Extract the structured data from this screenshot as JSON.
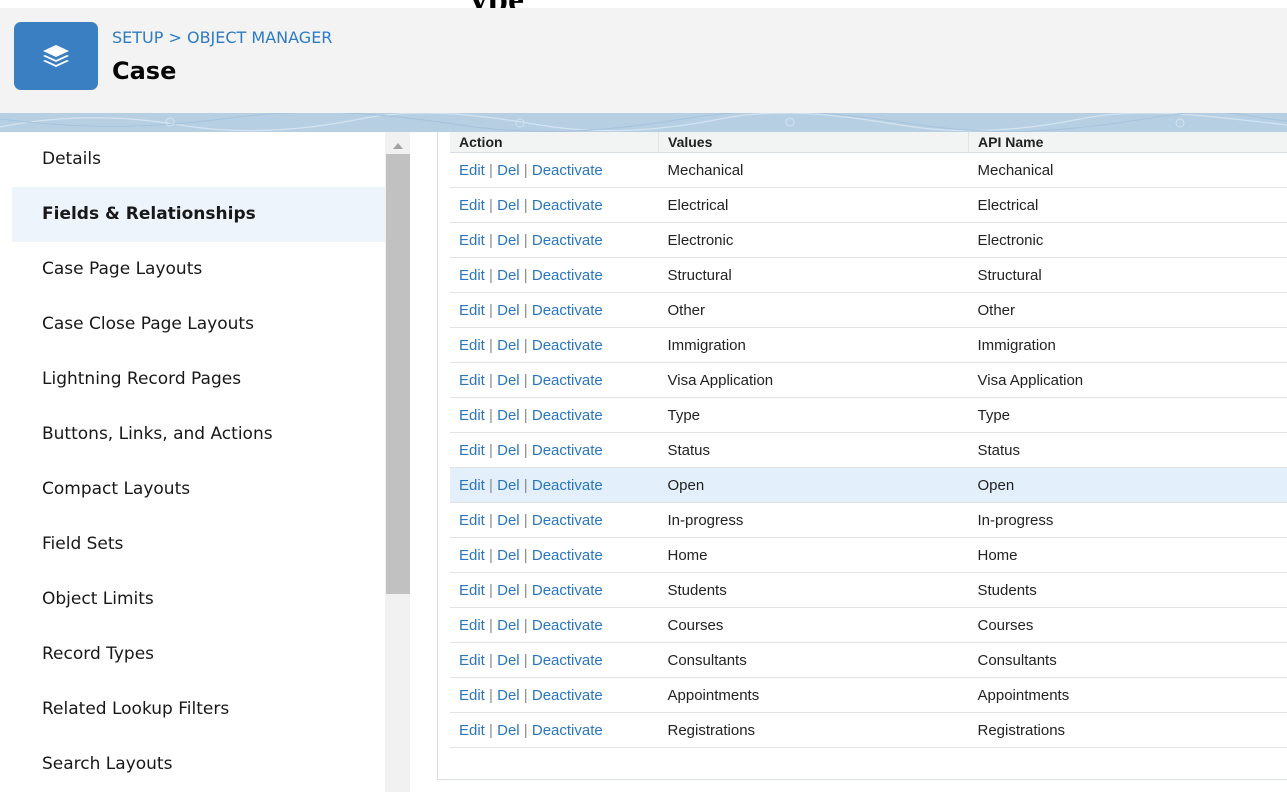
{
  "page_heading_fragment": "ype",
  "header": {
    "breadcrumb": "SETUP > OBJECT MANAGER",
    "object_title": "Case",
    "icon": "layers-icon"
  },
  "sidebar": {
    "items": [
      {
        "label": "Details",
        "active": false
      },
      {
        "label": "Fields & Relationships",
        "active": true
      },
      {
        "label": "Case Page Layouts",
        "active": false
      },
      {
        "label": "Case Close Page Layouts",
        "active": false
      },
      {
        "label": "Lightning Record Pages",
        "active": false
      },
      {
        "label": "Buttons, Links, and Actions",
        "active": false
      },
      {
        "label": "Compact Layouts",
        "active": false
      },
      {
        "label": "Field Sets",
        "active": false
      },
      {
        "label": "Object Limits",
        "active": false
      },
      {
        "label": "Record Types",
        "active": false
      },
      {
        "label": "Related Lookup Filters",
        "active": false
      },
      {
        "label": "Search Layouts",
        "active": false
      }
    ]
  },
  "table": {
    "columns": [
      "Action",
      "Values",
      "API Name"
    ],
    "actions": {
      "edit": "Edit",
      "del": "Del",
      "deactivate": "Deactivate",
      "separator": "|"
    },
    "rows": [
      {
        "value": "Mechanical",
        "api_name": "Mechanical"
      },
      {
        "value": "Electrical",
        "api_name": "Electrical"
      },
      {
        "value": "Electronic",
        "api_name": "Electronic"
      },
      {
        "value": "Structural",
        "api_name": "Structural"
      },
      {
        "value": "Other",
        "api_name": "Other"
      },
      {
        "value": "Immigration",
        "api_name": "Immigration"
      },
      {
        "value": "Visa Application",
        "api_name": "Visa Application"
      },
      {
        "value": "Type",
        "api_name": "Type"
      },
      {
        "value": "Status",
        "api_name": "Status"
      },
      {
        "value": "Open",
        "api_name": "Open"
      },
      {
        "value": "In-progress",
        "api_name": "In-progress"
      },
      {
        "value": "Home",
        "api_name": "Home"
      },
      {
        "value": "Students",
        "api_name": "Students"
      },
      {
        "value": "Courses",
        "api_name": "Courses"
      },
      {
        "value": "Consultants",
        "api_name": "Consultants"
      },
      {
        "value": "Appointments",
        "api_name": "Appointments"
      },
      {
        "value": "Registrations",
        "api_name": "Registrations"
      }
    ],
    "highlighted_row": 9
  },
  "colors": {
    "icon_bg": "#3a7fc1",
    "link": "#2a75c0",
    "active_item_bg": "#eef4fb",
    "highlight_row_bg": "#e3f0fb"
  }
}
